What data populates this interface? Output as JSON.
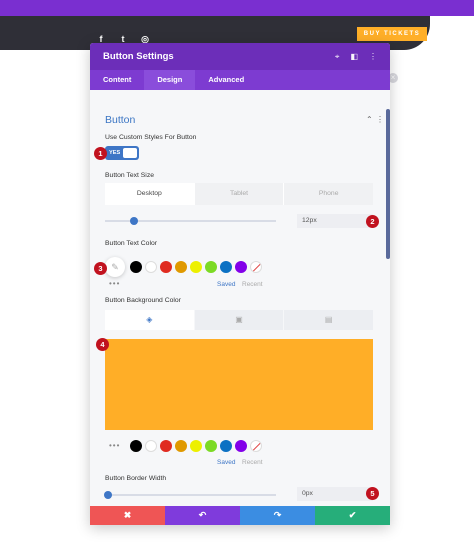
{
  "background": {
    "buy_tickets": "BUY TICKETS",
    "social_icons": [
      "facebook-icon",
      "twitter-icon",
      "instagram-icon"
    ]
  },
  "modal": {
    "title": "Button Settings",
    "header_controls": [
      "target-icon",
      "split-view-icon",
      "more-icon"
    ],
    "tabs": [
      {
        "label": "Content",
        "active": false
      },
      {
        "label": "Design",
        "active": true
      },
      {
        "label": "Advanced",
        "active": false
      }
    ]
  },
  "section": {
    "title": "Button",
    "use_custom_styles": {
      "label": "Use Custom Styles For Button",
      "toggle_text": "YES",
      "enabled": true
    },
    "text_size": {
      "label": "Button Text Size",
      "devices": [
        "Desktop",
        "Tablet",
        "Phone"
      ],
      "active_device": "Desktop",
      "value": "12px",
      "slider_fraction": 0.12
    },
    "text_color": {
      "label": "Button Text Color",
      "saved_label": "Saved",
      "recent_label": "Recent"
    },
    "background_color": {
      "label": "Button Background Color",
      "tabs": [
        "paint-bucket-icon",
        "image-icon",
        "gradient-icon"
      ],
      "value": "#ffae27",
      "saved_label": "Saved",
      "recent_label": "Recent"
    },
    "border_width": {
      "label": "Button Border Width",
      "value": "0px",
      "slider_fraction": 0.0
    }
  },
  "swatches": [
    "#000000",
    "#ffffff",
    "#e02b20",
    "#e09900",
    "#edf000",
    "#7cda24",
    "#0c71c3",
    "#8300e9",
    "none"
  ],
  "footer": {
    "buttons": [
      {
        "icon": "close-icon",
        "glyph": "✖",
        "color": "#ef5555"
      },
      {
        "icon": "undo-icon",
        "glyph": "↶",
        "color": "#7f3bdc"
      },
      {
        "icon": "redo-icon",
        "glyph": "↷",
        "color": "#3b8de2"
      },
      {
        "icon": "save-check-icon",
        "glyph": "✔",
        "color": "#26ae7a"
      }
    ]
  },
  "annotations": [
    "1",
    "2",
    "3",
    "4",
    "5"
  ],
  "colors": {
    "header": "#6c2eb9",
    "accent": "#3e76c6",
    "badge": "#c1121f"
  }
}
